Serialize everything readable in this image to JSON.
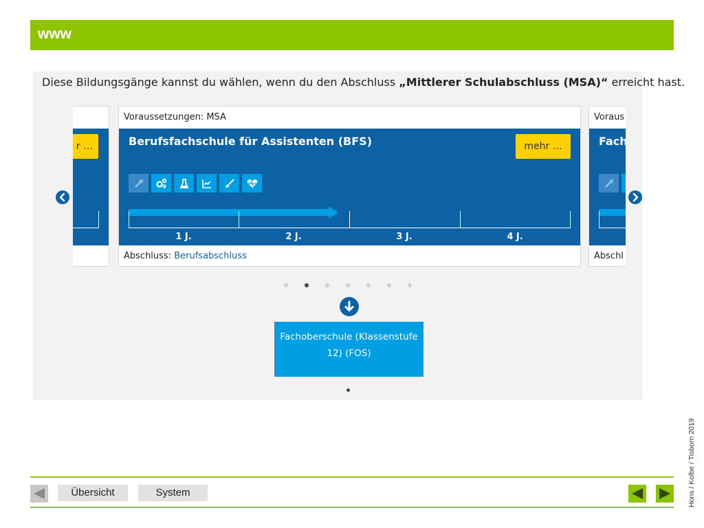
{
  "header": {
    "title": "www"
  },
  "intro": {
    "prefix": "Diese Bildungsgänge kannst du wählen, wenn du den Abschluss ",
    "highlight": "„Mittlerer Schulabschluss (MSA)“",
    "suffix": " erreicht hast."
  },
  "cards": {
    "left_partial": {
      "more_label": "r …"
    },
    "main": {
      "requirements": "Voraussetzungen: MSA",
      "title": "Berufsfachschule für Assistenten (BFS)",
      "more_label": "mehr …",
      "years": [
        "1 J.",
        "2 J.",
        "3 J.",
        "4 J."
      ],
      "duration_years": 2,
      "degree_label": "Abschluss: ",
      "degree_value": "Berufsabschluss",
      "icons": [
        "syringe-icon",
        "gears-icon",
        "flask-icon",
        "chart-icon",
        "brush-icon",
        "heartbeat-icon"
      ]
    },
    "right_partial": {
      "requirements": "Voraus",
      "title": "Fach",
      "degree_label": "Abschl"
    }
  },
  "carousel": {
    "slide_count": 7,
    "active_index": 1
  },
  "next_step": {
    "label": "Fachoberschule (Klassenstufe 12) (FOS)"
  },
  "footer": {
    "overview_label": "Übersicht",
    "system_label": "System",
    "credit": "Hons / Kolbe / Tisborn 2019"
  },
  "colors": {
    "accent_green": "#8dc400",
    "card_blue": "#0d62a6",
    "light_blue": "#009fe3",
    "button_yellow": "#ffd100"
  }
}
